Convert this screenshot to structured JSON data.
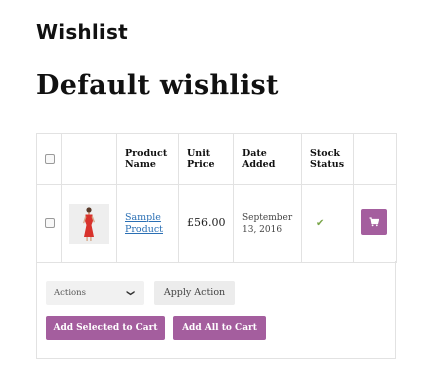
{
  "header": {
    "page_heading": "Wishlist",
    "wishlist_title": "Default wishlist"
  },
  "table": {
    "columns": {
      "name": "Product Name",
      "unit_price": "Unit Price",
      "date_added": "Date Added",
      "stock_status": "Stock Status"
    },
    "rows": [
      {
        "product_name": "Sample Product",
        "unit_price": "£56.00",
        "date_added": "September 13, 2016",
        "stock_icon": "check-icon",
        "thumbnail": "red-dress-product-image",
        "action_icon": "shopping-cart-icon"
      }
    ]
  },
  "actions": {
    "select_value": "Actions",
    "apply_label": "Apply Action",
    "add_selected_label": "Add Selected to Cart",
    "add_all_label": "Add All to Cart"
  },
  "colors": {
    "accent": "#a45e9e",
    "link": "#2a6fb4",
    "in_stock": "#7aa64a"
  }
}
